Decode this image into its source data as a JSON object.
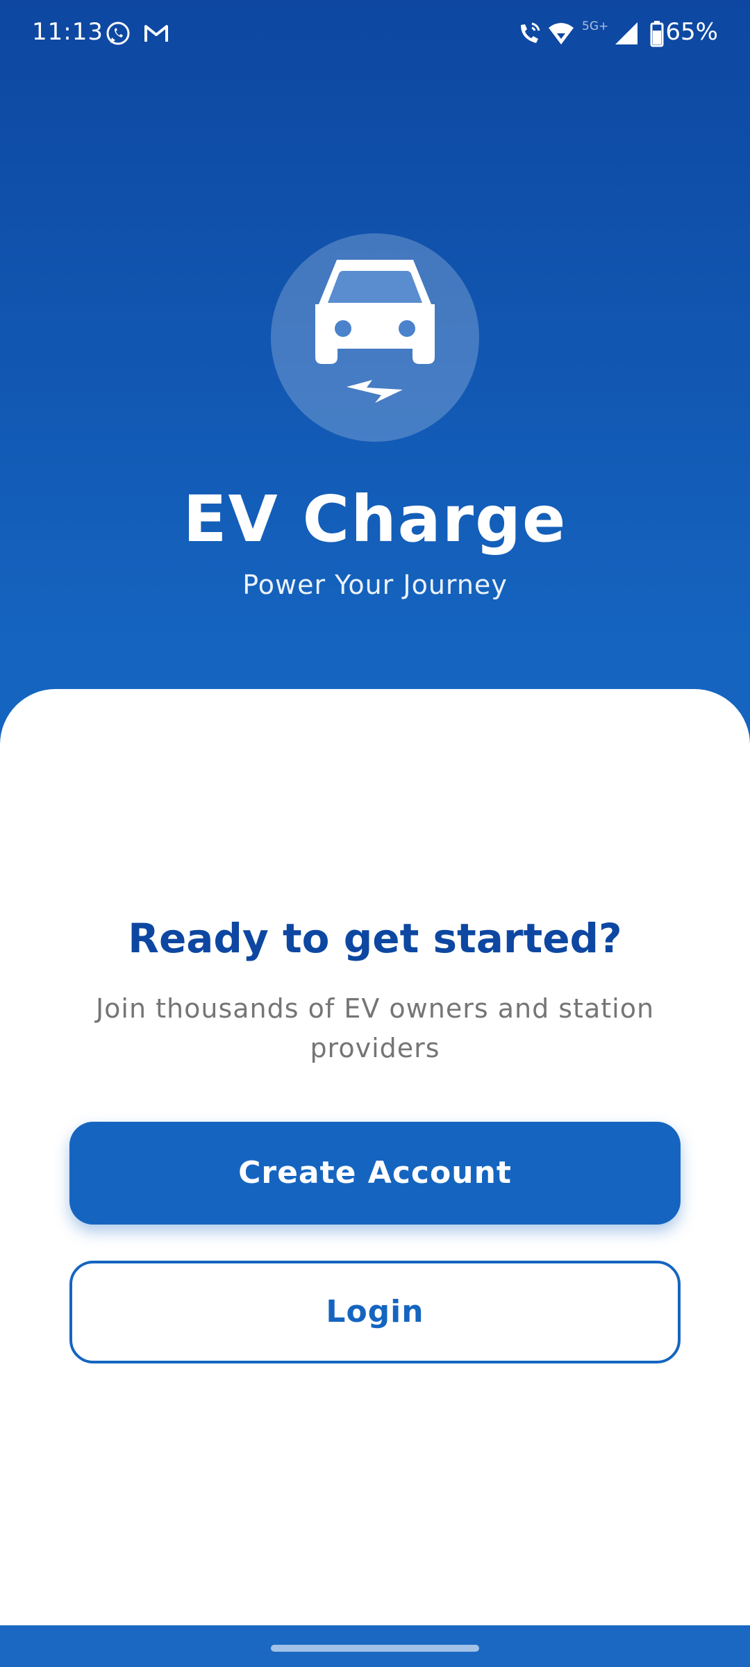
{
  "status_bar": {
    "time": "11:13",
    "network": "5G+",
    "battery": "65%",
    "icons": [
      "whatsapp-icon",
      "gmail-icon",
      "wifi-calling-icon",
      "wifi-icon",
      "signal-icon",
      "battery-icon"
    ]
  },
  "hero": {
    "logo_icon": "car-charging-icon",
    "title": "EV Charge",
    "tagline": "Power Your Journey"
  },
  "sheet": {
    "heading": "Ready to get started?",
    "subtitle": "Join thousands of EV owners and station providers",
    "create_account_label": "Create Account",
    "login_label": "Login"
  },
  "colors": {
    "primary": "#1565c0",
    "primary_dark": "#0d47a1",
    "subtitle_gray": "#757575",
    "sheet_bg": "#ffffff"
  }
}
